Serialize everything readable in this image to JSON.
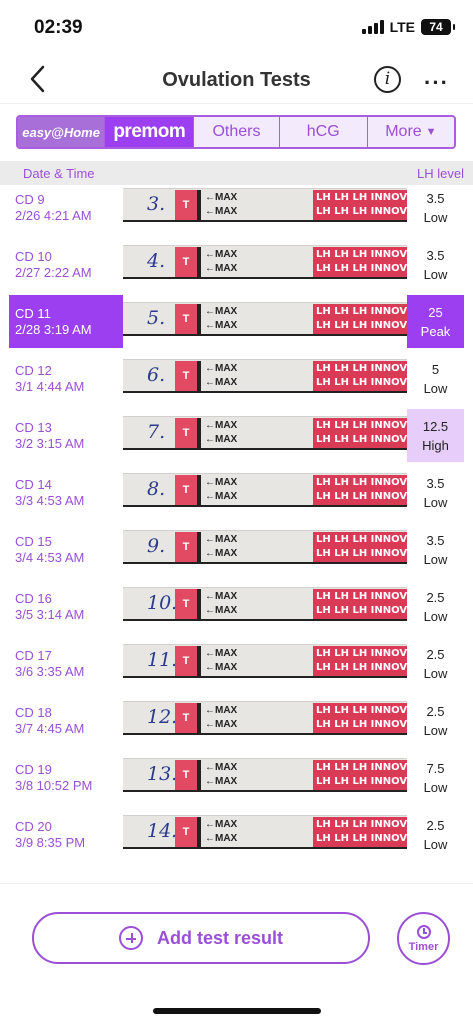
{
  "status_bar": {
    "time": "02:39",
    "network": "LTE",
    "battery": "74"
  },
  "header": {
    "title": "Ovulation Tests",
    "info_label": "i",
    "more_label": "···"
  },
  "brand_tabs": [
    {
      "label": "easy@Home"
    },
    {
      "label": "premom"
    },
    {
      "label": "Others"
    },
    {
      "label": "hCG"
    },
    {
      "label": "More"
    }
  ],
  "columns": {
    "date": "Date & Time",
    "lh": "LH level"
  },
  "strip_text": {
    "t": "T",
    "max": "MAX",
    "brand": "LH LH LH INNOVITA"
  },
  "rows": [
    {
      "cd": "CD 9",
      "datetime": "2/26 4:21 AM",
      "num": "3.",
      "level": "3.5",
      "status": "Low"
    },
    {
      "cd": "CD 10",
      "datetime": "2/27 2:22 AM",
      "num": "4.",
      "level": "3.5",
      "status": "Low"
    },
    {
      "cd": "CD 11",
      "datetime": "2/28 3:19 AM",
      "num": "5.",
      "level": "25",
      "status": "Peak"
    },
    {
      "cd": "CD 12",
      "datetime": "3/1 4:44 AM",
      "num": "6.",
      "level": "5",
      "status": "Low"
    },
    {
      "cd": "CD 13",
      "datetime": "3/2 3:15 AM",
      "num": "7.",
      "level": "12.5",
      "status": "High"
    },
    {
      "cd": "CD 14",
      "datetime": "3/3 4:53 AM",
      "num": "8.",
      "level": "3.5",
      "status": "Low"
    },
    {
      "cd": "CD 15",
      "datetime": "3/4 4:53 AM",
      "num": "9.",
      "level": "3.5",
      "status": "Low"
    },
    {
      "cd": "CD 16",
      "datetime": "3/5 3:14 AM",
      "num": "10.",
      "level": "2.5",
      "status": "Low"
    },
    {
      "cd": "CD 17",
      "datetime": "3/6 3:35 AM",
      "num": "11.",
      "level": "2.5",
      "status": "Low"
    },
    {
      "cd": "CD 18",
      "datetime": "3/7 4:45 AM",
      "num": "12.",
      "level": "2.5",
      "status": "Low"
    },
    {
      "cd": "CD 19",
      "datetime": "3/8 10:52 PM",
      "num": "13.",
      "level": "7.5",
      "status": "Low"
    },
    {
      "cd": "CD 20",
      "datetime": "3/9 8:35 PM",
      "num": "14.",
      "level": "2.5",
      "status": "Low"
    }
  ],
  "actions": {
    "add_label": "Add test result",
    "timer_label": "Timer"
  },
  "colors": {
    "accent": "#9b3ff0",
    "text_purple": "#9b4fd6",
    "high_bg": "#e6cdfa",
    "strip_red": "#d93b57"
  }
}
